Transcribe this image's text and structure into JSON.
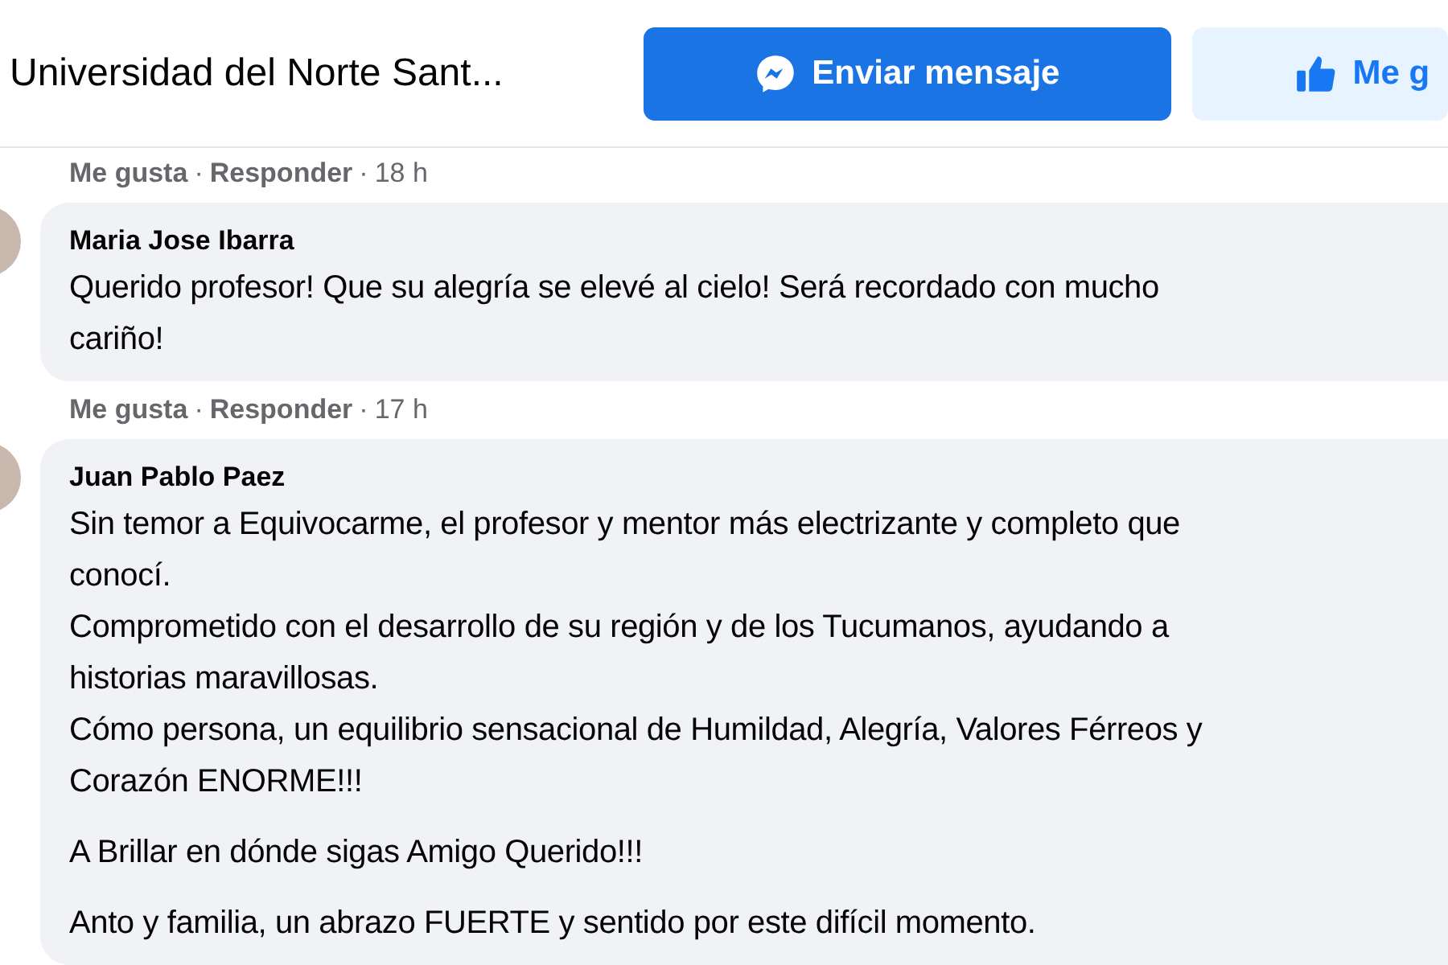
{
  "header": {
    "title": "Universidad del Norte Sant...",
    "buttons": [
      {
        "kind": "primary",
        "label": "Enviar mensaje"
      },
      {
        "kind": "secondary",
        "label": "Me g"
      }
    ]
  },
  "feed": [
    {
      "kind": "actions",
      "like": "Me gusta",
      "separator": "·",
      "reply": "Responder",
      "time": "18 h"
    },
    {
      "kind": "comment",
      "author": "Maria Jose Ibarra",
      "paragraphs": [
        [
          "Querido profesor! Que su alegría se elevé al cielo! Será recordado con mucho",
          "cariño!"
        ]
      ]
    },
    {
      "kind": "actions",
      "like": "Me gusta",
      "separator": "·",
      "reply": "Responder",
      "time": "17 h"
    },
    {
      "kind": "comment",
      "author": "Juan Pablo Paez",
      "paragraphs": [
        [
          "Sin temor a Equivocarme, el profesor y mentor más electrizante y completo que",
          "conocí.",
          "Comprometido con el desarrollo de su región y de los Tucumanos, ayudando a",
          "historias maravillosas.",
          "Cómo persona, un equilibrio sensacional de Humildad, Alegría, Valores Férreos y",
          "Corazón ENORME!!!"
        ],
        [
          "A Brillar en dónde sigas Amigo Querido!!!"
        ],
        [
          "Anto y familia, un abrazo FUERTE y sentido por este difícil momento."
        ]
      ]
    }
  ]
}
